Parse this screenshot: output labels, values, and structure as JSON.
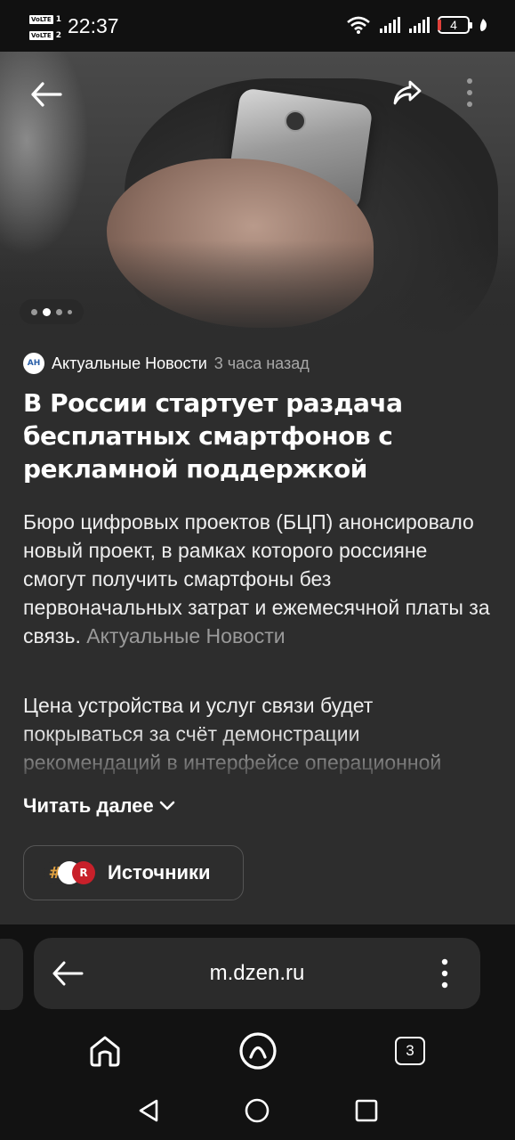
{
  "status_bar": {
    "sim1_label": "VoLTE",
    "sim1_number": "1",
    "sim2_label": "VoLTE",
    "sim2_number": "2",
    "time": "22:37",
    "battery_level": "4",
    "icons": [
      "wifi-icon",
      "signal-icon",
      "signal-icon",
      "battery-icon",
      "leaf-icon"
    ]
  },
  "hero": {
    "slide_count": 4,
    "active_slide": 2,
    "icons": [
      "back-arrow-icon",
      "share-icon",
      "more-vertical-icon"
    ]
  },
  "article": {
    "source_logo_text": "АН",
    "source_name": "Актуальные Новости",
    "time_ago": "3 часа назад",
    "title": "В России стартует раздача бесплатных смартфонов с рекламной поддержкой",
    "paragraph1": "Бюро цифровых проектов (БЦП) анонсировало новый проект, в рамках которого россияне смогут получить смартфоны без первоначальных затрат и ежемесячной платы за связь.",
    "paragraph1_citation": "Актуальные Новости",
    "paragraph2": "Цена устройства и услуг связи будет покрываться за счёт демонстрации рекомендаций в интерфейсе операционной системы",
    "read_more": "Читать далее",
    "sources_button": "Источники"
  },
  "browser": {
    "url": "m.dzen.ru",
    "tab_count": "3",
    "icons": [
      "back-arrow-icon",
      "more-vertical-icon",
      "home-icon",
      "alice-icon",
      "tabs-icon"
    ]
  },
  "system_nav": {
    "icons": [
      "back-triangle-icon",
      "home-circle-icon",
      "recents-square-icon"
    ]
  },
  "colors": {
    "article_bg": "#2d2d2d",
    "browser_bg": "#121212",
    "secondary_text": "#a8a8a8"
  }
}
